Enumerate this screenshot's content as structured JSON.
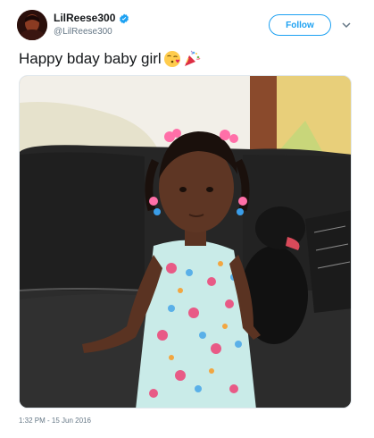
{
  "tweet": {
    "display_name": "LilReese300",
    "handle": "@LilReese300",
    "verified_icon": "verified-badge-icon",
    "follow_label": "Follow",
    "menu_icon": "chevron-down-icon",
    "text": "Happy bday baby girl",
    "emojis": [
      "face-blowing-kiss-emoji",
      "party-popper-emoji"
    ],
    "timestamp": "1:32 PM - 15 Jun 2016"
  },
  "colors": {
    "accent": "#1da1f2",
    "secondary_text": "#657786",
    "primary_text": "#14171a"
  }
}
